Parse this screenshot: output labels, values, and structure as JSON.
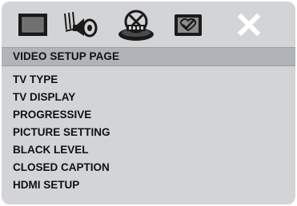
{
  "toolbar": {
    "icons": [
      {
        "name": "general-setup-icon",
        "selected": false
      },
      {
        "name": "audio-setup-icon",
        "selected": false
      },
      {
        "name": "video-setup-icon",
        "selected": true
      },
      {
        "name": "preference-setup-icon",
        "selected": false
      },
      {
        "name": "exit-icon",
        "selected": false
      }
    ]
  },
  "page_title": "VIDEO SETUP PAGE",
  "menu_items": [
    "TV TYPE",
    "TV DISPLAY",
    "PROGRESSIVE",
    "PICTURE SETTING",
    "BLACK LEVEL",
    "CLOSED CAPTION",
    "HDMI SETUP"
  ],
  "colors": {
    "panel": "#d2d4d6",
    "header_bar": "#b0b3b7",
    "icon_dark": "#1a1a1a"
  }
}
